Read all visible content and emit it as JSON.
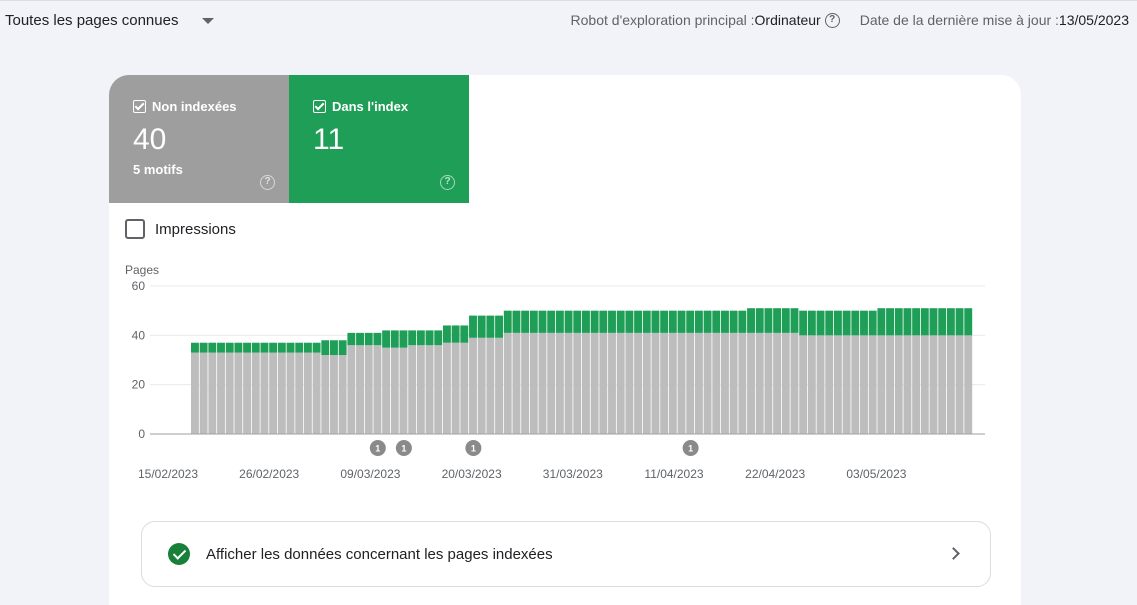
{
  "topbar": {
    "filter_label": "Toutes les pages connues",
    "crawler_label": "Robot d'exploration principal : ",
    "crawler_value": "Ordinateur",
    "update_label": "Date de la dernière mise à jour : ",
    "update_value": "13/05/2023"
  },
  "tiles": [
    {
      "label": "Non indexées",
      "value": "40",
      "sub": "5 motifs",
      "color": "#9e9e9e"
    },
    {
      "label": "Dans l'index",
      "value": "11",
      "sub": "",
      "color": "#1e9e57"
    }
  ],
  "impressions_label": "Impressions",
  "chart_data": {
    "type": "bar",
    "stacked": true,
    "ylabel": "Pages",
    "ylim": [
      0,
      60
    ],
    "yticks": [
      0,
      20,
      40,
      60
    ],
    "xtick_labels": [
      "15/02/2023",
      "26/02/2023",
      "09/03/2023",
      "20/03/2023",
      "31/03/2023",
      "11/04/2023",
      "22/04/2023",
      "03/05/2023"
    ],
    "series": [
      {
        "name": "Non indexées",
        "color": "#bdbdbd",
        "values": [
          33,
          33,
          33,
          33,
          33,
          33,
          33,
          33,
          33,
          33,
          33,
          33,
          33,
          33,
          33,
          32,
          32,
          32,
          36,
          36,
          36,
          36,
          35,
          35,
          35,
          36,
          36,
          36,
          36,
          37,
          37,
          37,
          39,
          39,
          39,
          39,
          41,
          41,
          41,
          41,
          41,
          41,
          41,
          41,
          41,
          41,
          41,
          41,
          41,
          41,
          41,
          41,
          41,
          41,
          41,
          41,
          41,
          41,
          41,
          41,
          41,
          41,
          41,
          41,
          41,
          41,
          41,
          41,
          41,
          41,
          40,
          40,
          40,
          40,
          40,
          40,
          40,
          40,
          40,
          40,
          40,
          40,
          40,
          40,
          40,
          40,
          40,
          40,
          40,
          40
        ]
      },
      {
        "name": "Dans l'index",
        "color": "#1e9e57",
        "values": [
          4,
          4,
          4,
          4,
          4,
          4,
          4,
          4,
          4,
          4,
          4,
          4,
          4,
          4,
          4,
          6,
          6,
          6,
          5,
          5,
          5,
          5,
          7,
          7,
          7,
          6,
          6,
          6,
          6,
          7,
          7,
          7,
          9,
          9,
          9,
          9,
          9,
          9,
          9,
          9,
          9,
          9,
          9,
          9,
          9,
          9,
          9,
          9,
          9,
          9,
          9,
          9,
          9,
          9,
          9,
          9,
          9,
          9,
          9,
          9,
          9,
          9,
          9,
          9,
          10,
          10,
          10,
          10,
          10,
          10,
          10,
          10,
          10,
          10,
          10,
          10,
          10,
          10,
          10,
          11,
          11,
          11,
          11,
          11,
          11,
          11,
          11,
          11,
          11,
          11
        ]
      }
    ],
    "annotations": [
      {
        "index": 21,
        "label": "1"
      },
      {
        "index": 24,
        "label": "1"
      },
      {
        "index": 32,
        "label": "1"
      },
      {
        "index": 57,
        "label": "1"
      }
    ]
  },
  "indexed_link_label": "Afficher les données concernant les pages indexées",
  "colors": {
    "accent_green": "#1e9e57",
    "gray": "#9e9e9e",
    "ok": "#188038"
  },
  "icons": {
    "checkbox": "check-icon",
    "help": "help-circle-icon",
    "dropdown": "caret-down-icon",
    "ok": "check-circle-icon",
    "chevron": "chevron-right-icon"
  }
}
